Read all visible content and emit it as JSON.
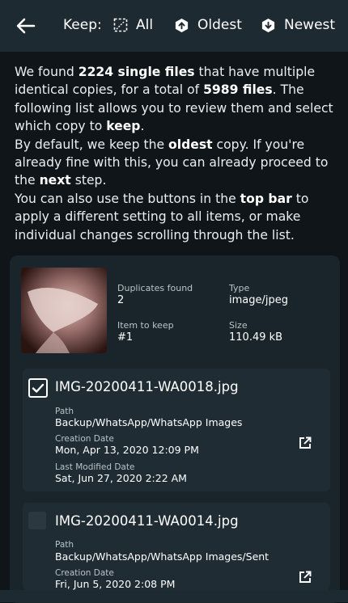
{
  "header": {
    "keep_label": "Keep:",
    "options": [
      {
        "label": "All",
        "icon": "select-all-icon"
      },
      {
        "label": "Oldest",
        "icon": "arrow-up-hexagon-icon"
      },
      {
        "label": "Newest",
        "icon": "arrow-down-hexagon-icon"
      }
    ]
  },
  "intro": {
    "p1_a": "We found ",
    "p1_b": "2224 single files",
    "p1_c": " that have multiple identical copies, for a total of ",
    "p1_d": "5989 files",
    "p1_e": ". The following list allows you to review them and select which copy to ",
    "p1_f": "keep",
    "p1_g": ".",
    "p2_a": "By default, we keep the ",
    "p2_b": "oldest",
    "p2_c": " copy. If you're already fine with this, you can already proceed to the ",
    "p2_d": "next",
    "p2_e": " step.",
    "p3_a": "You can also use the buttons in the ",
    "p3_b": "top bar",
    "p3_c": " to apply a different setting to all items, or make individual changes scrolling through the list."
  },
  "group": {
    "duplicates_label": "Duplicates found",
    "duplicates_value": "2",
    "type_label": "Type",
    "type_value": "image/jpeg",
    "keep_label": "Item to keep",
    "keep_value": "#1",
    "size_label": "Size",
    "size_value": "110.49 kB"
  },
  "files": [
    {
      "checked": true,
      "name": "IMG-20200411-WA0018.jpg",
      "path_label": "Path",
      "path": "Backup/WhatsApp/WhatsApp Images",
      "created_label": "Creation Date",
      "created": "Mon, Apr 13, 2020 12:09 PM",
      "modified_label": "Last Modified Date",
      "modified": "Sat, Jun 27, 2020 2:22 AM"
    },
    {
      "checked": false,
      "name": "IMG-20200411-WA0014.jpg",
      "path_label": "Path",
      "path": "Backup/WhatsApp/WhatsApp Images/Sent",
      "created_label": "Creation Date",
      "created": "Fri, Jun 5, 2020 2:08 PM"
    }
  ],
  "colors": {
    "background": "#0f1518",
    "topbar": "#1e2a31",
    "card": "#1a252b",
    "file_card": "#1f2c33",
    "accent": "#ffffff"
  }
}
